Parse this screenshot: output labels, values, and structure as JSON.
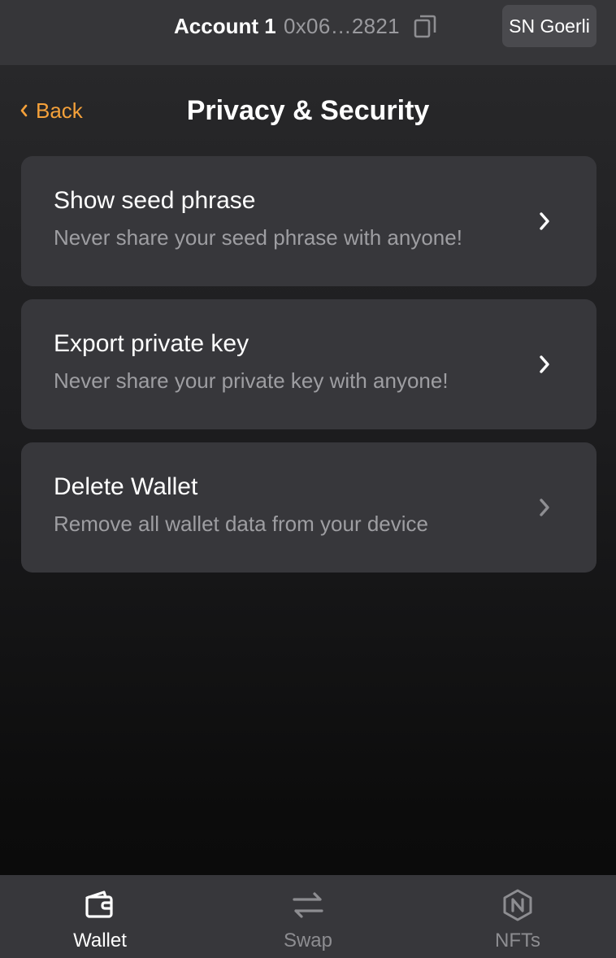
{
  "header": {
    "account_name": "Account 1",
    "account_address": "0x06…2821",
    "network": "SN Goerli"
  },
  "page": {
    "back_label": "Back",
    "title": "Privacy & Security"
  },
  "settings": [
    {
      "title": "Show seed phrase",
      "subtitle": "Never share your seed phrase with anyone!"
    },
    {
      "title": "Export private key",
      "subtitle": "Never share your private key with anyone!"
    },
    {
      "title": "Delete Wallet",
      "subtitle": "Remove all wallet data from your device"
    }
  ],
  "nav": {
    "tabs": [
      {
        "label": "Wallet",
        "icon": "wallet-icon",
        "active": true
      },
      {
        "label": "Swap",
        "icon": "swap-icon",
        "active": false
      },
      {
        "label": "NFTs",
        "icon": "nft-icon",
        "active": false
      }
    ]
  },
  "colors": {
    "accent": "#f5a13a",
    "card_background": "#37373b",
    "subtitle_text": "#9e9ea2",
    "inactive_tab": "#8d8d91"
  }
}
